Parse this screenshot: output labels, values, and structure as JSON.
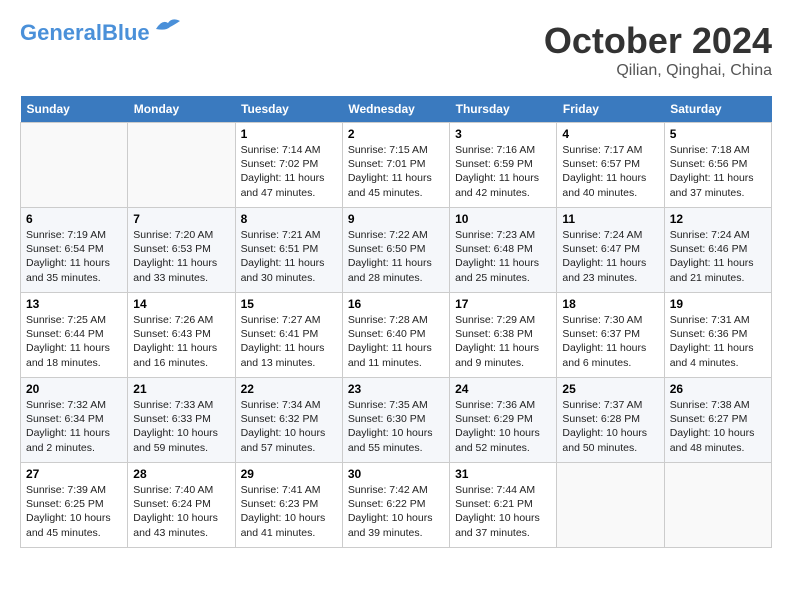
{
  "header": {
    "logo_line1": "General",
    "logo_line2": "Blue",
    "month": "October 2024",
    "location": "Qilian, Qinghai, China"
  },
  "weekdays": [
    "Sunday",
    "Monday",
    "Tuesday",
    "Wednesday",
    "Thursday",
    "Friday",
    "Saturday"
  ],
  "weeks": [
    [
      {
        "num": "",
        "info": ""
      },
      {
        "num": "",
        "info": ""
      },
      {
        "num": "1",
        "info": "Sunrise: 7:14 AM\nSunset: 7:02 PM\nDaylight: 11 hours and 47 minutes."
      },
      {
        "num": "2",
        "info": "Sunrise: 7:15 AM\nSunset: 7:01 PM\nDaylight: 11 hours and 45 minutes."
      },
      {
        "num": "3",
        "info": "Sunrise: 7:16 AM\nSunset: 6:59 PM\nDaylight: 11 hours and 42 minutes."
      },
      {
        "num": "4",
        "info": "Sunrise: 7:17 AM\nSunset: 6:57 PM\nDaylight: 11 hours and 40 minutes."
      },
      {
        "num": "5",
        "info": "Sunrise: 7:18 AM\nSunset: 6:56 PM\nDaylight: 11 hours and 37 minutes."
      }
    ],
    [
      {
        "num": "6",
        "info": "Sunrise: 7:19 AM\nSunset: 6:54 PM\nDaylight: 11 hours and 35 minutes."
      },
      {
        "num": "7",
        "info": "Sunrise: 7:20 AM\nSunset: 6:53 PM\nDaylight: 11 hours and 33 minutes."
      },
      {
        "num": "8",
        "info": "Sunrise: 7:21 AM\nSunset: 6:51 PM\nDaylight: 11 hours and 30 minutes."
      },
      {
        "num": "9",
        "info": "Sunrise: 7:22 AM\nSunset: 6:50 PM\nDaylight: 11 hours and 28 minutes."
      },
      {
        "num": "10",
        "info": "Sunrise: 7:23 AM\nSunset: 6:48 PM\nDaylight: 11 hours and 25 minutes."
      },
      {
        "num": "11",
        "info": "Sunrise: 7:24 AM\nSunset: 6:47 PM\nDaylight: 11 hours and 23 minutes."
      },
      {
        "num": "12",
        "info": "Sunrise: 7:24 AM\nSunset: 6:46 PM\nDaylight: 11 hours and 21 minutes."
      }
    ],
    [
      {
        "num": "13",
        "info": "Sunrise: 7:25 AM\nSunset: 6:44 PM\nDaylight: 11 hours and 18 minutes."
      },
      {
        "num": "14",
        "info": "Sunrise: 7:26 AM\nSunset: 6:43 PM\nDaylight: 11 hours and 16 minutes."
      },
      {
        "num": "15",
        "info": "Sunrise: 7:27 AM\nSunset: 6:41 PM\nDaylight: 11 hours and 13 minutes."
      },
      {
        "num": "16",
        "info": "Sunrise: 7:28 AM\nSunset: 6:40 PM\nDaylight: 11 hours and 11 minutes."
      },
      {
        "num": "17",
        "info": "Sunrise: 7:29 AM\nSunset: 6:38 PM\nDaylight: 11 hours and 9 minutes."
      },
      {
        "num": "18",
        "info": "Sunrise: 7:30 AM\nSunset: 6:37 PM\nDaylight: 11 hours and 6 minutes."
      },
      {
        "num": "19",
        "info": "Sunrise: 7:31 AM\nSunset: 6:36 PM\nDaylight: 11 hours and 4 minutes."
      }
    ],
    [
      {
        "num": "20",
        "info": "Sunrise: 7:32 AM\nSunset: 6:34 PM\nDaylight: 11 hours and 2 minutes."
      },
      {
        "num": "21",
        "info": "Sunrise: 7:33 AM\nSunset: 6:33 PM\nDaylight: 10 hours and 59 minutes."
      },
      {
        "num": "22",
        "info": "Sunrise: 7:34 AM\nSunset: 6:32 PM\nDaylight: 10 hours and 57 minutes."
      },
      {
        "num": "23",
        "info": "Sunrise: 7:35 AM\nSunset: 6:30 PM\nDaylight: 10 hours and 55 minutes."
      },
      {
        "num": "24",
        "info": "Sunrise: 7:36 AM\nSunset: 6:29 PM\nDaylight: 10 hours and 52 minutes."
      },
      {
        "num": "25",
        "info": "Sunrise: 7:37 AM\nSunset: 6:28 PM\nDaylight: 10 hours and 50 minutes."
      },
      {
        "num": "26",
        "info": "Sunrise: 7:38 AM\nSunset: 6:27 PM\nDaylight: 10 hours and 48 minutes."
      }
    ],
    [
      {
        "num": "27",
        "info": "Sunrise: 7:39 AM\nSunset: 6:25 PM\nDaylight: 10 hours and 45 minutes."
      },
      {
        "num": "28",
        "info": "Sunrise: 7:40 AM\nSunset: 6:24 PM\nDaylight: 10 hours and 43 minutes."
      },
      {
        "num": "29",
        "info": "Sunrise: 7:41 AM\nSunset: 6:23 PM\nDaylight: 10 hours and 41 minutes."
      },
      {
        "num": "30",
        "info": "Sunrise: 7:42 AM\nSunset: 6:22 PM\nDaylight: 10 hours and 39 minutes."
      },
      {
        "num": "31",
        "info": "Sunrise: 7:44 AM\nSunset: 6:21 PM\nDaylight: 10 hours and 37 minutes."
      },
      {
        "num": "",
        "info": ""
      },
      {
        "num": "",
        "info": ""
      }
    ]
  ]
}
